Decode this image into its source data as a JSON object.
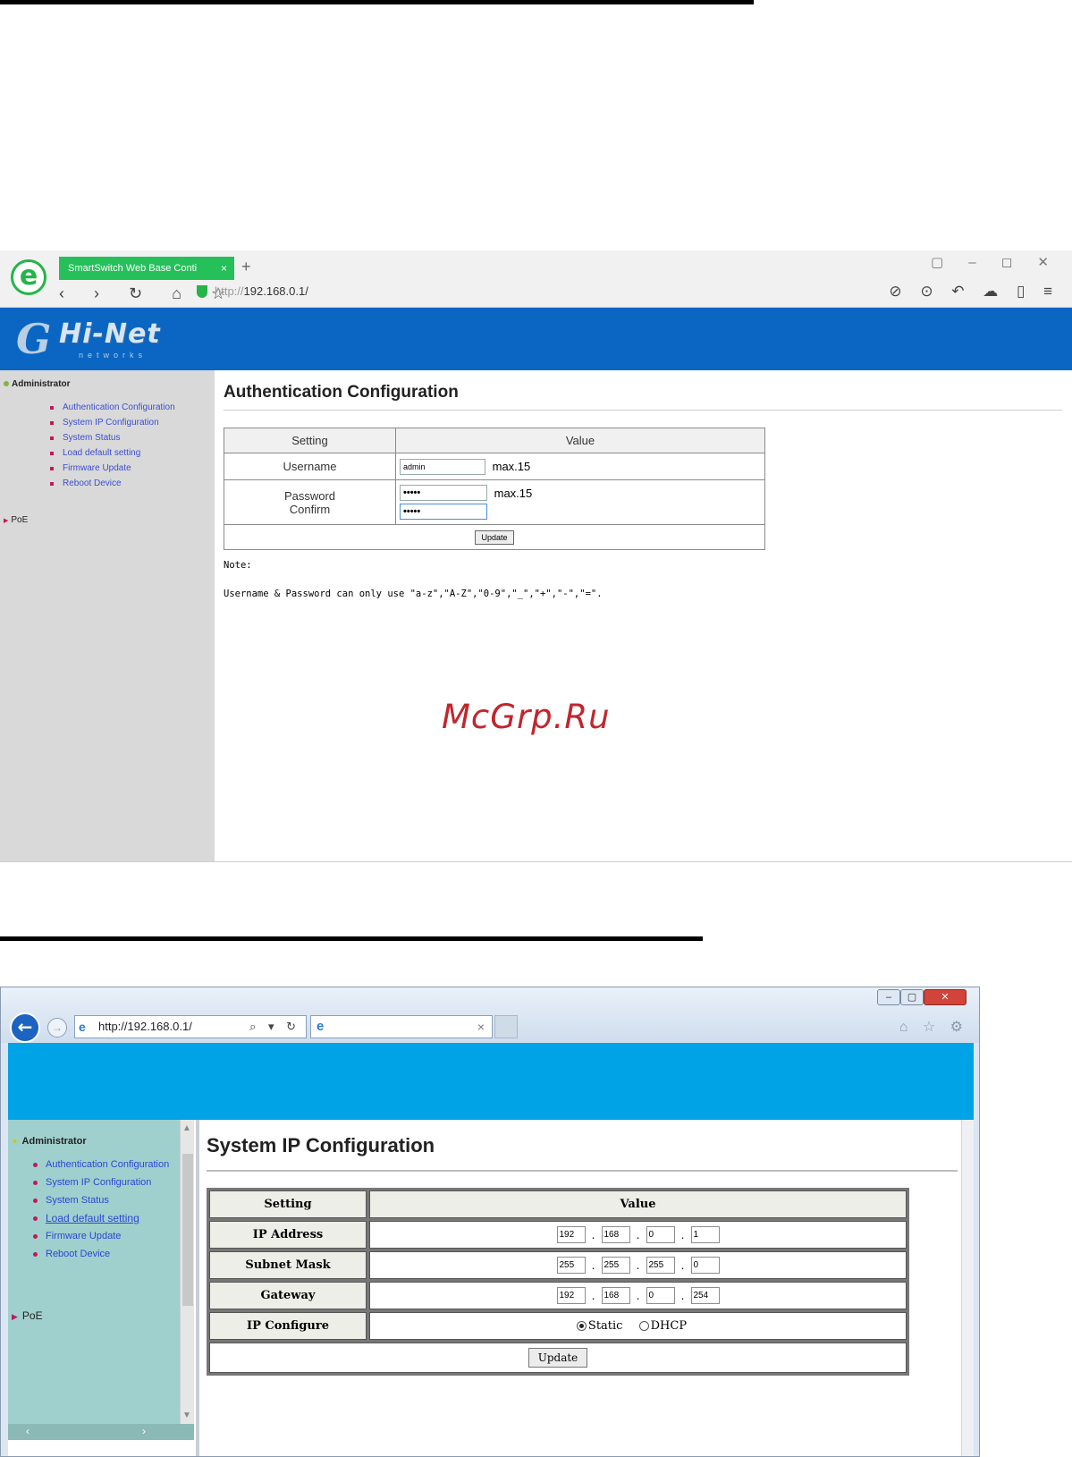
{
  "screenshot1": {
    "browser": {
      "tab_title": "SmartSwitch Web Base Conti",
      "tab_close": "×",
      "new_tab": "+",
      "window_controls": "▢ – ◻ ✕",
      "nav_glyphs": "‹ › ↻ ⌂ ☆",
      "address_proto": "http://",
      "address_host": "192.168.0.1/",
      "right_tools": "⊘ ⊙ ↶ ☁ ▯ ≡"
    },
    "logo": {
      "mark": "G",
      "brand": "Hi-Net",
      "sub": "networks"
    },
    "sidebar": {
      "section": "Administrator",
      "items": [
        "Authentication Configuration",
        "System IP Configuration",
        "System Status",
        "Load default setting",
        "Firmware Update",
        "Reboot Device"
      ],
      "poe": "PoE"
    },
    "page_title": "Authentication Configuration",
    "table": {
      "header_setting": "Setting",
      "header_value": "Value",
      "username_label": "Username",
      "username_value": "admin",
      "username_max": "max.15",
      "password_label": "Password",
      "confirm_label": "Confirm",
      "password_value": "•••••",
      "confirm_value": "•••••",
      "password_max": "max.15",
      "update_button": "Update"
    },
    "note_title": "Note:",
    "note_text": "Username & Password can only use \"a-z\",\"A-Z\",\"0-9\",\"_\",\"+\",\"-\",\"=\".",
    "watermark": "McGrp.Ru"
  },
  "screenshot2": {
    "browser": {
      "address": "http://192.168.0.1/",
      "addr_tools": "⌕ ▾ ↻",
      "back": "←",
      "forward": "→",
      "tab_close": "×",
      "window_min": "–",
      "window_max": "▢",
      "window_close": "✕",
      "right_tools": "⌂ ☆ ⚙"
    },
    "sidebar": {
      "section": "Administrator",
      "items": [
        "Authentication Configuration",
        "System IP Configuration",
        "System Status",
        "Load default setting",
        "Firmware Update",
        "Reboot Device"
      ],
      "poe": "PoE",
      "scroll_left": "‹",
      "scroll_right": "›"
    },
    "page_title": "System IP Configuration",
    "table": {
      "header_setting": "Setting",
      "header_value": "Value",
      "ip_label": "IP Address",
      "ip": [
        "192",
        "168",
        "0",
        "1"
      ],
      "mask_label": "Subnet Mask",
      "mask": [
        "255",
        "255",
        "255",
        "0"
      ],
      "gateway_label": "Gateway",
      "gateway": [
        "192",
        "168",
        "0",
        "254"
      ],
      "ipconf_label": "IP Configure",
      "static_label": "Static",
      "dhcp_label": "DHCP",
      "update_button": "Update"
    }
  }
}
